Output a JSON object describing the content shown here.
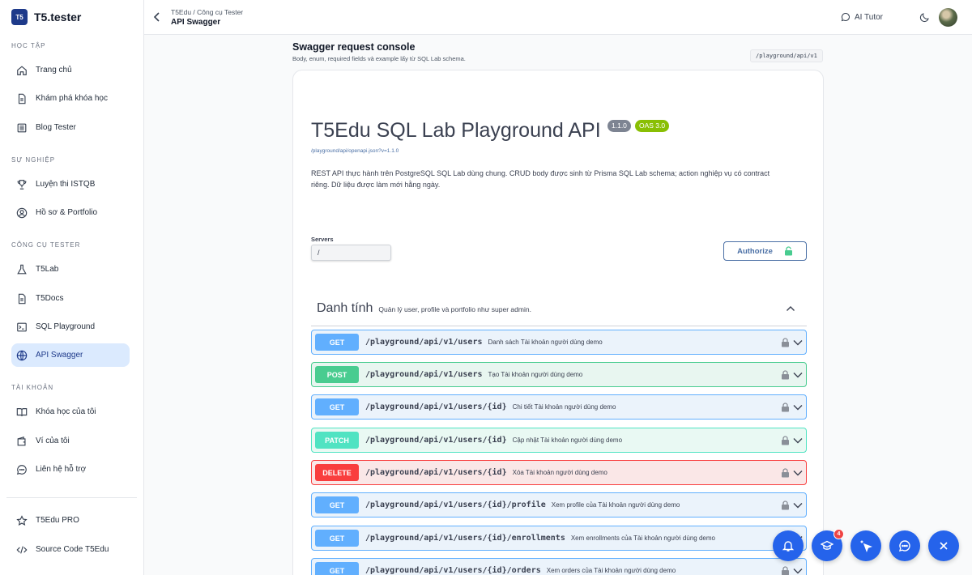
{
  "brand": {
    "logo_text": "T5",
    "name": "T5.tester"
  },
  "sidebar": {
    "sections": [
      {
        "label": "HỌC TẬP"
      },
      {
        "label": "SỰ NGHIỆP"
      },
      {
        "label": "CÔNG CỤ TESTER"
      },
      {
        "label": "TÀI KHOẢN"
      }
    ],
    "items": [
      {
        "label": "Trang chủ",
        "icon": "home-icon"
      },
      {
        "label": "Khám phá khóa học",
        "icon": "document-icon"
      },
      {
        "label": "Blog Tester",
        "icon": "newspaper-icon"
      },
      {
        "label": "Luyện thi ISTQB",
        "icon": "trophy-icon"
      },
      {
        "label": "Hồ sơ & Portfolio",
        "icon": "user-circle-icon"
      },
      {
        "label": "T5Lab",
        "icon": "flask-icon"
      },
      {
        "label": "T5Docs",
        "icon": "document-icon"
      },
      {
        "label": "SQL Playground",
        "icon": "terminal-icon"
      },
      {
        "label": "API Swagger",
        "icon": "globe-icon",
        "active": true
      },
      {
        "label": "Khóa học của tôi",
        "icon": "book-icon"
      },
      {
        "label": "Ví của tôi",
        "icon": "wallet-icon"
      },
      {
        "label": "Liên hệ hỗ trợ",
        "icon": "chat-icon"
      },
      {
        "label": "T5Edu PRO",
        "icon": "star-icon"
      },
      {
        "label": "Source Code T5Edu",
        "icon": "code-icon"
      }
    ]
  },
  "header": {
    "breadcrumb": "T5Edu / Công cụ Tester",
    "title": "API Swagger",
    "ai_tutor": "AI Tutor"
  },
  "console": {
    "title": "Swagger request console",
    "subtitle": "Body, enum, required fields và example lấy từ SQL Lab schema.",
    "path_tag": "/playground/api/v1"
  },
  "swagger": {
    "api_title": "T5Edu SQL Lab Playground API",
    "version": "1.1.0",
    "oas": "OAS 3.0",
    "spec_link": "/playground/api/openapi.json?v=1.1.0",
    "description": "REST API thực hành trên PostgreSQL SQL Lab dùng chung. CRUD body được sinh từ Prisma SQL Lab schema; action nghiệp vụ có contract riêng. Dữ liệu được làm mới hằng ngày.",
    "servers_label": "Servers",
    "server_value": "/",
    "authorize_label": "Authorize",
    "tag": {
      "name": "Danh tính",
      "description": "Quản lý user, profile và portfolio như super admin."
    },
    "operations": [
      {
        "method": "GET",
        "path": "/playground/api/v1/users",
        "summary": "Danh sách Tài khoản người dùng demo"
      },
      {
        "method": "POST",
        "path": "/playground/api/v1/users",
        "summary": "Tạo Tài khoản người dùng demo"
      },
      {
        "method": "GET",
        "path": "/playground/api/v1/users/{id}",
        "summary": "Chi tiết Tài khoản người dùng demo"
      },
      {
        "method": "PATCH",
        "path": "/playground/api/v1/users/{id}",
        "summary": "Cập nhật Tài khoản người dùng demo"
      },
      {
        "method": "DELETE",
        "path": "/playground/api/v1/users/{id}",
        "summary": "Xóa Tài khoản người dùng demo"
      },
      {
        "method": "GET",
        "path": "/playground/api/v1/users/{id}/profile",
        "summary": "Xem profile của Tài khoản người dùng demo"
      },
      {
        "method": "GET",
        "path": "/playground/api/v1/users/{id}/enrollments",
        "summary": "Xem enrollments của Tài khoản người dùng demo"
      },
      {
        "method": "GET",
        "path": "/playground/api/v1/users/{id}/orders",
        "summary": "Xem orders của Tài khoản người dùng demo"
      }
    ]
  },
  "fabs": [
    {
      "icon": "bell-icon"
    },
    {
      "icon": "graduation-cap-icon",
      "badge": "4"
    },
    {
      "icon": "sparkle-cursor-icon"
    },
    {
      "icon": "chat-bubble-icon"
    },
    {
      "icon": "close-icon"
    }
  ],
  "colors": {
    "accent": "#2563eb",
    "active_bg": "#dbeafe",
    "get": "#61affe",
    "post": "#49cc90",
    "patch": "#50e3c2",
    "delete": "#f93e3e"
  }
}
